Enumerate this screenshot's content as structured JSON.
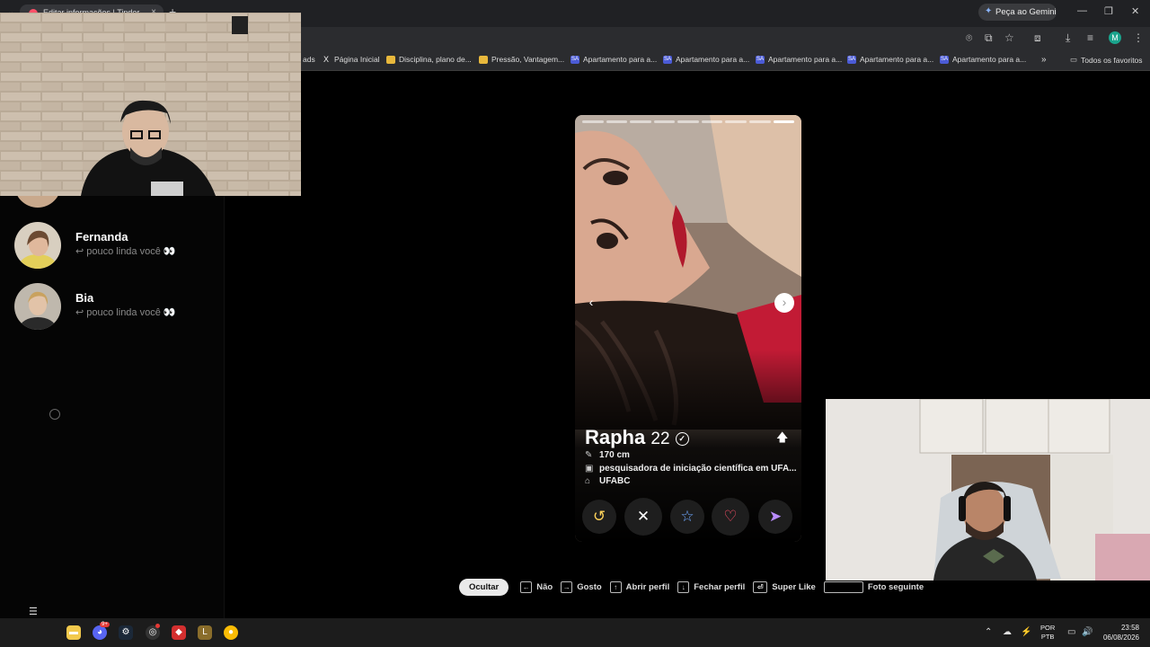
{
  "browser": {
    "tab_title": "Editar informações | Tinder",
    "tab_close": "×",
    "new_tab": "+",
    "gemini_label": "Peça ao Gemini",
    "bookmarks": [
      {
        "label": "ads",
        "icon": "none"
      },
      {
        "label": "Página Inicial",
        "icon": "x-icon"
      },
      {
        "label": "Disciplina, plano de...",
        "icon": "folder-icon"
      },
      {
        "label": "Pressão, Vantagem...",
        "icon": "folder-icon"
      },
      {
        "label": "Apartamento para a...",
        "icon": "sa-icon"
      },
      {
        "label": "Apartamento para a...",
        "icon": "sa-icon"
      },
      {
        "label": "Apartamento para a...",
        "icon": "sa-icon"
      },
      {
        "label": "Apartamento para a...",
        "icon": "sa-icon"
      },
      {
        "label": "Apartamento para a...",
        "icon": "sa-icon"
      }
    ],
    "all_favorites": "Todos os favoritos",
    "profile_letter": "M",
    "sa_glyph": "SA"
  },
  "sidebar": {
    "matches": [
      {
        "name": "Fernanda",
        "message": "↩ pouco linda você 👀"
      },
      {
        "name": "Bia",
        "message": "↩ pouco linda você 👀"
      }
    ]
  },
  "card": {
    "photo_count": 9,
    "photo_active_index": 8,
    "name": "Rapha",
    "age": "22",
    "height": "170 cm",
    "job": "pesquisadora de iniciação científica em UFA...",
    "school": "UFABC",
    "actions": [
      "rewind",
      "nope",
      "super-like",
      "like",
      "boost"
    ]
  },
  "shortcuts": {
    "hide": "Ocultar",
    "no": "Não",
    "like": "Gosto",
    "open_profile": "Abrir perfil",
    "close_profile": "Fechar perfil",
    "super_like": "Super Like",
    "next_photo": "Foto seguinte"
  },
  "taskbar": {
    "discord_badge": "9+",
    "lang_top": "POR",
    "lang_bottom": "PTB",
    "time": "23:58",
    "date": "06/08/2026"
  },
  "colors": {
    "like": "#fd5068",
    "superlike": "#6fa8ff",
    "brand": "#fd5068"
  }
}
